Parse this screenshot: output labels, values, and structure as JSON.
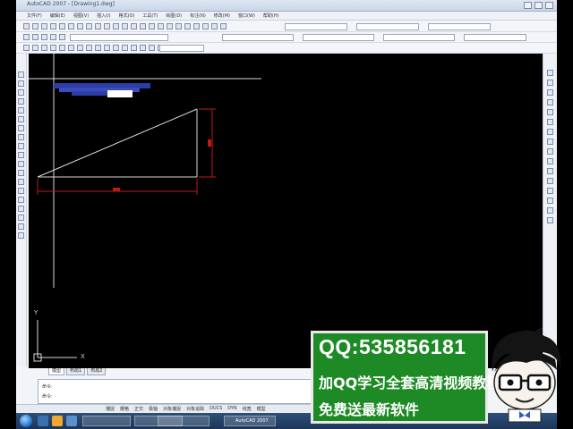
{
  "window": {
    "title": "AutoCAD 2007 - [Drawing1.dwg]"
  },
  "menubar": {
    "items": [
      "文件(F)",
      "编辑(E)",
      "视图(V)",
      "插入(I)",
      "格式(O)",
      "工具(T)",
      "绘图(D)",
      "标注(N)",
      "修改(M)",
      "窗口(W)",
      "帮助(H)"
    ]
  },
  "canvas": {
    "background": "#000000",
    "ucs_y_label": "Y",
    "ucs_x_label": "X"
  },
  "layout_tabs": [
    "模型",
    "布局1",
    "布局2"
  ],
  "command_line": {
    "line1": "命令:",
    "line2": "命令:"
  },
  "statusbar": {
    "items": [
      "捕捉",
      "栅格",
      "正交",
      "极轴",
      "对象捕捉",
      "对象追踪",
      "DUCS",
      "DYN",
      "线宽",
      "模型"
    ]
  },
  "taskbar": {
    "tasks": [
      "",
      "",
      "",
      "AutoCAD 2007"
    ]
  },
  "banner": {
    "qq_line": "QQ:535856181",
    "line2": "加QQ学习全套高清视频教程",
    "line3": "免费送最新软件",
    "background": "#1e8a25"
  }
}
